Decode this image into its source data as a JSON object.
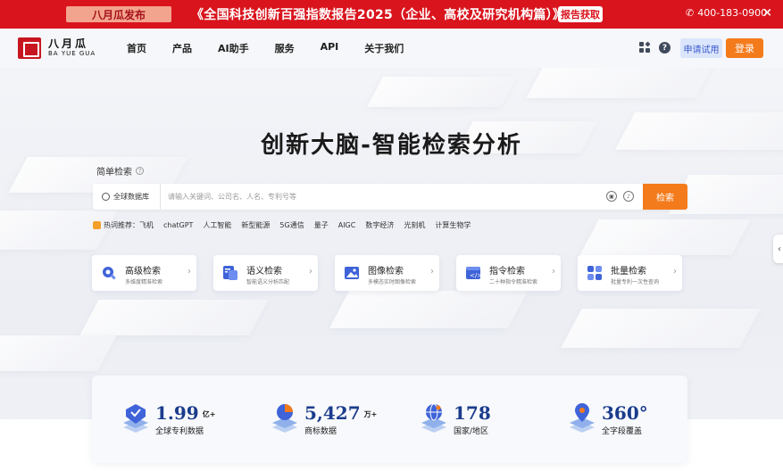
{
  "promo": {
    "tag": "八月瓜发布",
    "text": "《全国科技创新百强指数报告2025（企业、高校及研究机构篇）》",
    "button": "报告获取",
    "phone": "400-183-0900",
    "close": "×"
  },
  "nav": {
    "logo_cn": "八月瓜",
    "logo_en": "BA YUE GUA",
    "links": [
      "首页",
      "产品",
      "AI助手",
      "服务",
      "API",
      "关于我们"
    ],
    "trial": "申请试用",
    "login": "登录"
  },
  "hero": {
    "title": "创新大脑-智能检索分析",
    "simple_search_label": "简单检索",
    "db_select": "全球数据库",
    "search_placeholder": "请输入关键词、公司名、人名、专利号等",
    "search_button": "检索",
    "hot_label": "热词推荐：",
    "hot_words": [
      "飞机",
      "chatGPT",
      "人工智能",
      "新型能源",
      "5G通信",
      "量子",
      "AIGC",
      "数字经济",
      "光刻机",
      "计算生物学"
    ]
  },
  "cards": [
    {
      "title": "高级检索",
      "sub": "多维度精准检索",
      "icon": "gear-search-icon",
      "color": "#3f63d8"
    },
    {
      "title": "语义检索",
      "sub": "智能语义分析匹配",
      "icon": "semantic-doc-icon",
      "color": "#3f63d8"
    },
    {
      "title": "图像检索",
      "sub": "多模态实时图像检索",
      "icon": "image-icon",
      "color": "#3f63d8"
    },
    {
      "title": "指令检索",
      "sub": "二十种指令精准检索",
      "icon": "command-icon",
      "color": "#3f63d8"
    },
    {
      "title": "批量检索",
      "sub": "批量专利一次性查询",
      "icon": "batch-icon",
      "color": "#3f63d8"
    }
  ],
  "stats": [
    {
      "value": "1.99",
      "unit": "亿+",
      "label": "全球专利数据",
      "icon": "patent-stack-icon"
    },
    {
      "value": "5,427",
      "unit": "万+",
      "label": "商标数据",
      "icon": "pie-stack-icon"
    },
    {
      "value": "178",
      "unit": "",
      "label": "国家/地区",
      "icon": "globe-stack-icon"
    },
    {
      "value": "360°",
      "unit": "",
      "label": "全字段覆盖",
      "icon": "location-stack-icon"
    }
  ],
  "colors": {
    "brand_red": "#d9141d",
    "accent_orange": "#f47b1c",
    "stat_blue": "#1a3c8c"
  }
}
